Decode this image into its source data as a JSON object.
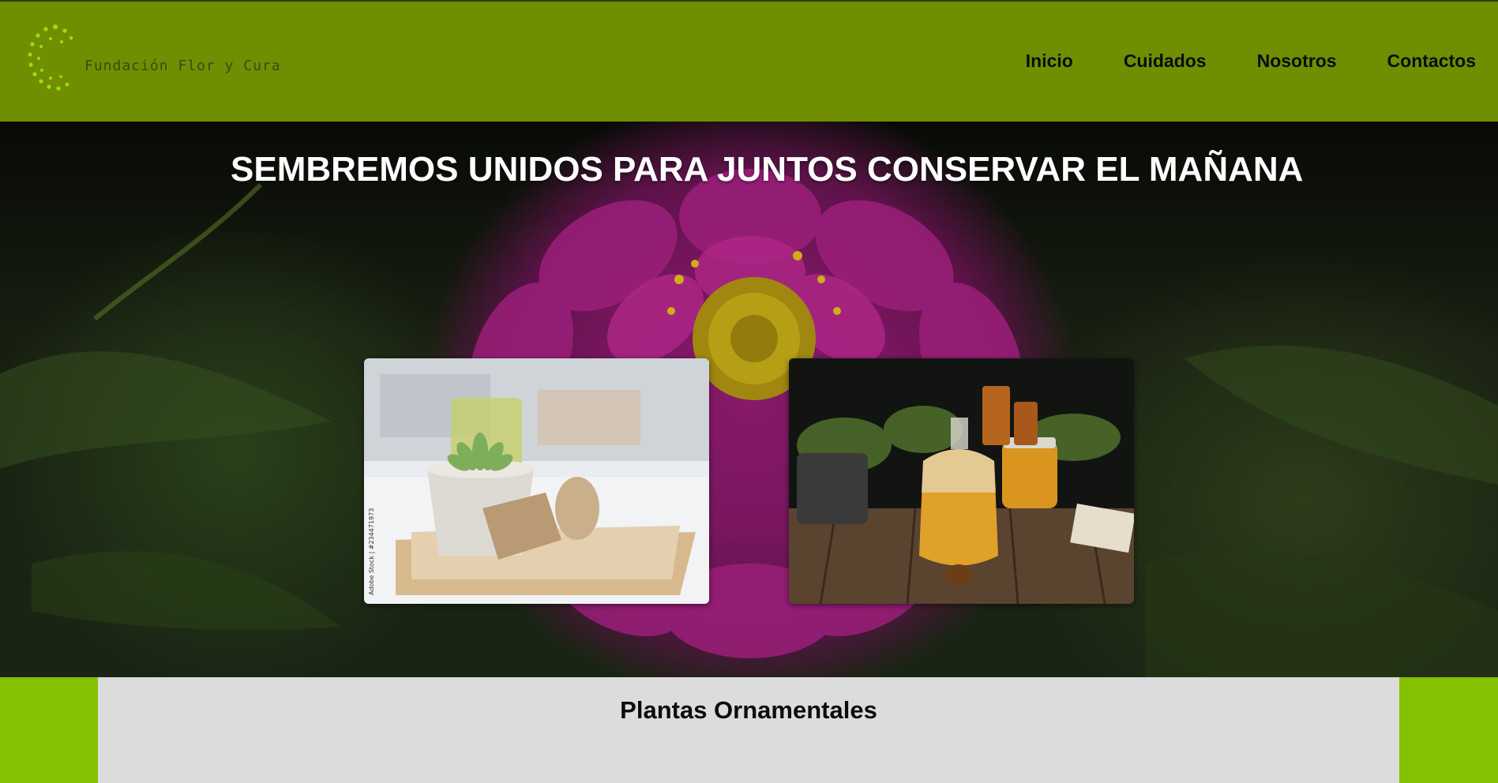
{
  "header": {
    "logo_text": "Fundación Flor y Cura",
    "nav": [
      {
        "label": "Inicio"
      },
      {
        "label": "Cuidados"
      },
      {
        "label": "Nosotros"
      },
      {
        "label": "Contactos"
      }
    ]
  },
  "hero": {
    "title": "SEMBREMOS UNIDOS PARA JUNTOS CONSERVAR EL MAÑANA",
    "cards": [
      {
        "image": "succulent-in-pot-photo",
        "watermark": "Adobe Stock | #234471973"
      },
      {
        "image": "herbal-oils-photo"
      }
    ]
  },
  "section": {
    "title": "Plantas Ornamentales"
  },
  "colors": {
    "header_bg": "#6f8f00",
    "accent_green": "#86c100",
    "section_bg": "#dcdcdc",
    "logo_dots": "#9be000"
  }
}
